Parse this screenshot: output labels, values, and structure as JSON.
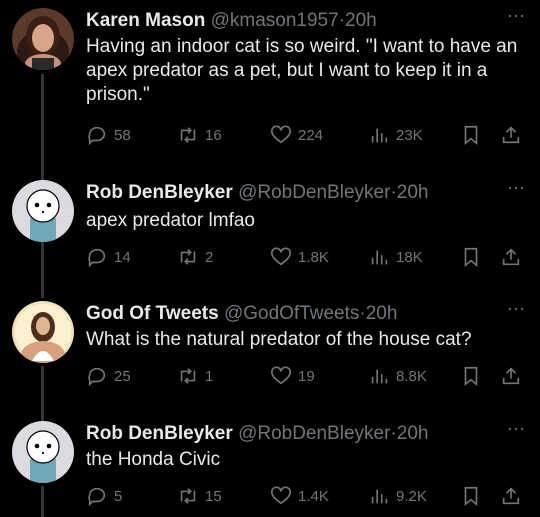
{
  "tweets": [
    {
      "name": "Karen Mason",
      "handle": "@kmason1957",
      "time": "20h",
      "text": "Having an indoor cat is so weird. \"I want to have an apex predator as a pet, but I want to keep it in a prison.\"",
      "replies": "58",
      "retweets": "16",
      "likes": "224",
      "views": "23K"
    },
    {
      "name": "Rob DenBleyker",
      "handle": "@RobDenBleyker",
      "time": "20h",
      "text": "apex predator lmfao",
      "replies": "14",
      "retweets": "2",
      "likes": "1.8K",
      "views": "18K"
    },
    {
      "name": "God Of Tweets",
      "handle": "@GodOfTweets",
      "time": "20h",
      "text": "What is the natural predator of the house cat?",
      "replies": "25",
      "retweets": "1",
      "likes": "19",
      "views": "8.8K"
    },
    {
      "name": "Rob DenBleyker",
      "handle": "@RobDenBleyker",
      "time": "20h",
      "text": "the Honda Civic",
      "replies": "5",
      "retweets": "15",
      "likes": "1.4K",
      "views": "9.2K"
    }
  ],
  "separator": "·",
  "icons": {
    "reply": "speech-bubble-icon",
    "retweet": "retweet-arrows-icon",
    "like": "heart-icon",
    "views": "bar-chart-icon",
    "bookmark": "bookmark-icon",
    "share": "share-upload-icon",
    "more": "ellipsis-icon"
  },
  "colors": {
    "background": "#000000",
    "text": "#e7e9ea",
    "muted": "#71767b",
    "thread_line": "#333639"
  }
}
